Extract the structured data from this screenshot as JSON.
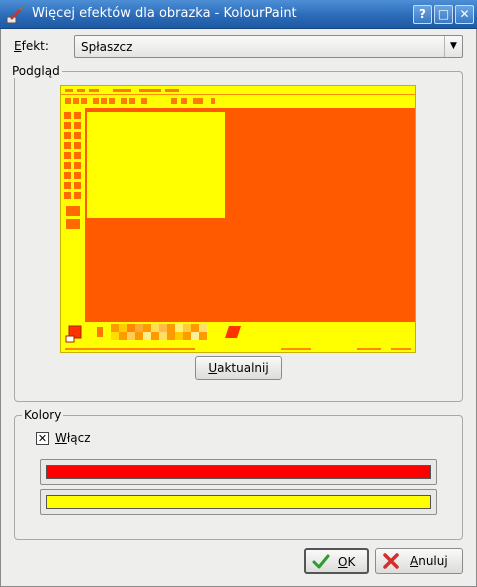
{
  "window": {
    "title": "Więcej efektów dla obrazka - KolourPaint",
    "controls": {
      "help": "?",
      "maximize": "□",
      "close": "✕"
    },
    "icon": "paintbrush-icon"
  },
  "effect": {
    "label": "Efekt:",
    "label_accel": "E",
    "label_rest": "fekt:",
    "selected": "Spłaszcz"
  },
  "preview": {
    "group_title": "Podgląd",
    "update_button": "Uaktualnij",
    "update_accel": "U",
    "update_rest": "aktualnij",
    "image_colors": {
      "background": "#ff5a00",
      "foreground": "#ffff00"
    }
  },
  "colors": {
    "group_title": "Kolory",
    "enable_checkbox": {
      "label": "Włącz",
      "label_accel": "W",
      "label_rest": "łącz",
      "checked": true
    },
    "color1": "#ff0000",
    "color2": "#ffff00"
  },
  "buttons": {
    "ok": "OK",
    "ok_accel": "O",
    "ok_rest": "K",
    "cancel": "Anuluj",
    "cancel_accel": "A",
    "cancel_rest": "nuluj"
  }
}
